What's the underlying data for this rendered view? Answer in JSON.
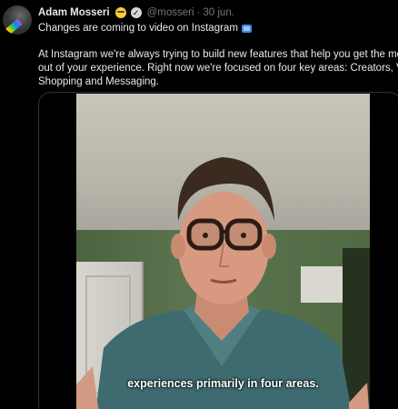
{
  "author": {
    "name": "Adam Mosseri",
    "handle": "@mosseri",
    "separator": "·",
    "date": "30 jun."
  },
  "tweet": {
    "title": "Changes are coming to video on Instagram",
    "body_lines": [
      "At Instagram we're always trying to build new features that help you get the most",
      "out of your experience. Right now we're focused on four key areas: Creators, Video,",
      "Shopping and Messaging."
    ]
  },
  "video": {
    "caption": "experiences primarily in four areas."
  },
  "icons": {
    "avatar": "profile-photo",
    "name_emoji": "grimacing-face-emoji",
    "verified": "verified-badge",
    "title_emoji": "television-emoji"
  },
  "colors": {
    "background": "#000000",
    "text": "#e7e9ea",
    "secondary_text": "#71767b",
    "border": "#2f3336",
    "tv_emoji": "#3f8be5"
  }
}
